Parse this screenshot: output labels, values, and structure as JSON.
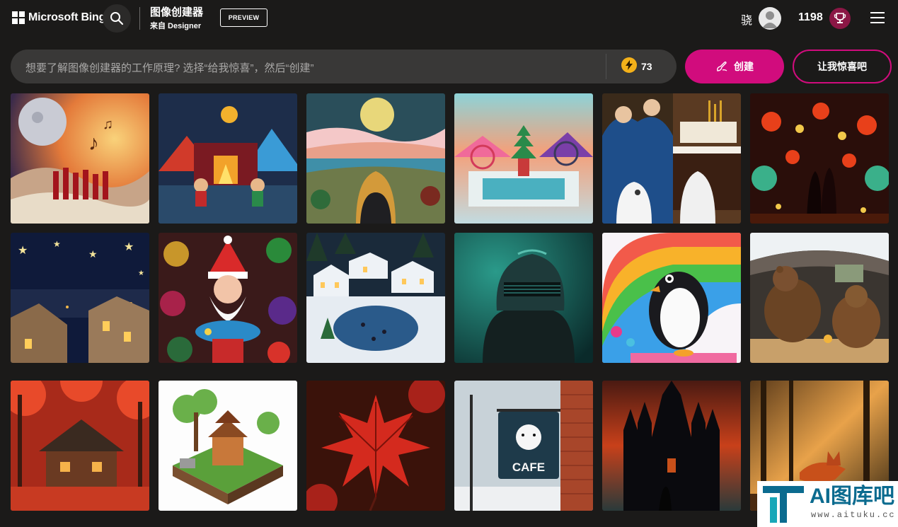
{
  "header": {
    "brand": "Microsoft Bing",
    "title": "图像创建器",
    "subtitle": "来自 Designer",
    "preview_badge": "PREVIEW",
    "user_name": "骁",
    "points": "1198"
  },
  "prompt": {
    "placeholder": "想要了解图像创建器的工作原理? 选择“给我惊喜”，然后“创建”",
    "boosts": "73"
  },
  "actions": {
    "create_label": "创建",
    "surprise_label": "让我惊喜吧"
  },
  "gallery": {
    "images": [
      {
        "scene": "starry-moon-music-crowd"
      },
      {
        "scene": "felt-campfire-family"
      },
      {
        "scene": "felt-moon-forest-girl"
      },
      {
        "scene": "papercraft-pagoda-fair"
      },
      {
        "scene": "singers-piano-cats-menorah"
      },
      {
        "scene": "lantern-festival-couple"
      },
      {
        "scene": "night-town-stars"
      },
      {
        "scene": "santa-with-fish-ornaments"
      },
      {
        "scene": "snowy-village-skating"
      },
      {
        "scene": "teal-robot-portrait"
      },
      {
        "scene": "penguin-rainbow"
      },
      {
        "scene": "bears-in-cozy-cave"
      },
      {
        "scene": "autumn-forest-cabin"
      },
      {
        "scene": "isometric-pagoda-island"
      },
      {
        "scene": "red-maple-leaf"
      },
      {
        "scene": "polar-bear-cafe-sign"
      },
      {
        "scene": "gothic-castle-silhouette"
      },
      {
        "scene": "fox-in-forest"
      }
    ],
    "cafe_sign_text": "CAFE"
  },
  "watermark": {
    "brand": "AI图库吧",
    "url": "www.aituku.cc"
  },
  "colors": {
    "accent": "#d10c7d",
    "background": "#1b1a19",
    "prompt_bg": "#393837"
  }
}
